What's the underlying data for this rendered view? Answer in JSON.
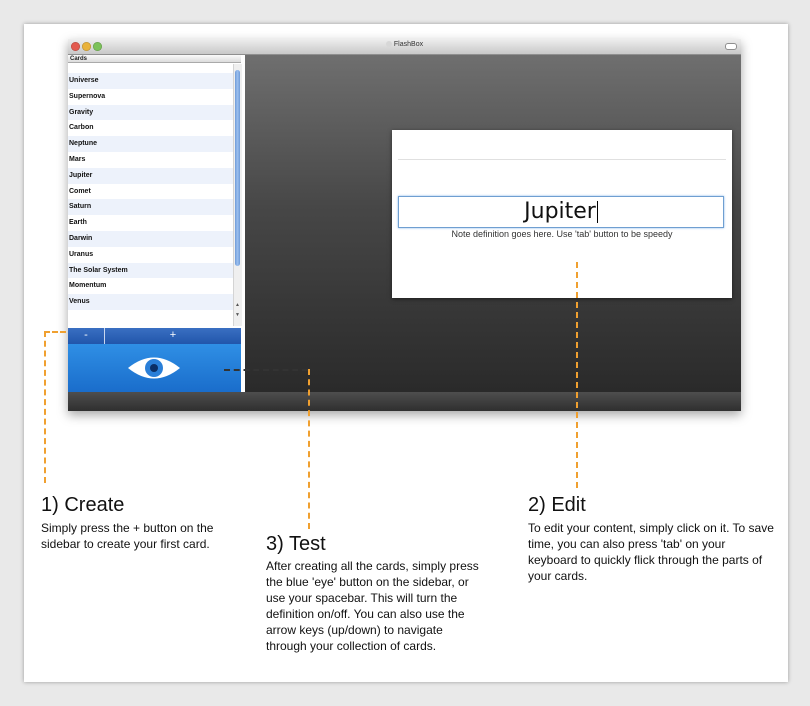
{
  "window": {
    "title": "FlashBox"
  },
  "sidebar": {
    "header": "Cards",
    "cards": [
      "Universe",
      "Supernova",
      "Gravity",
      "Carbon",
      "Neptune",
      "Mars",
      "Jupiter",
      "Comet",
      "Saturn",
      "Earth",
      "Darwin",
      "Uranus",
      "The Solar System",
      "Momentum",
      "Venus"
    ],
    "remove_label": "-",
    "add_label": "+"
  },
  "card": {
    "term": "Jupiter",
    "definition": "Note definition goes here. Use 'tab' button to be speedy"
  },
  "callouts": {
    "create": {
      "heading": "1) Create",
      "body": "Simply press the + button on the sidebar to create your first card."
    },
    "test": {
      "heading": "3) Test",
      "body": "After creating all the cards, simply press the blue 'eye' button on the sidebar, or use your spacebar. This will turn the definition on/off. You can also use the arrow keys (up/down) to navigate through your collection of cards."
    },
    "edit": {
      "heading": "2) Edit",
      "body": "To edit your content, simply click on it. To save time, you can also press 'tab' on your keyboard to quickly flick through the parts of your cards."
    }
  },
  "colors": {
    "accent_blue": "#1a6dcb",
    "dash_orange": "#f0a030"
  }
}
